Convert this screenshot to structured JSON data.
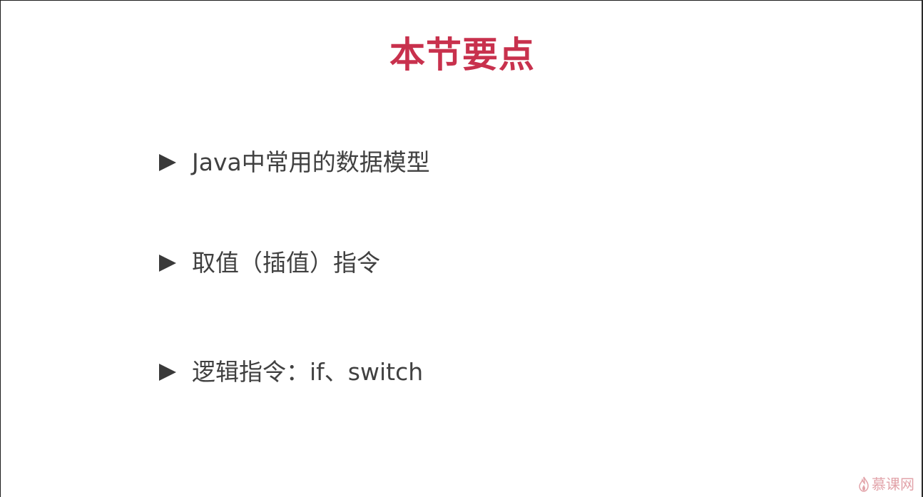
{
  "slide": {
    "title": "本节要点",
    "bullets": [
      {
        "text": "Java中常用的数据模型"
      },
      {
        "text": "取值（插值）指令"
      },
      {
        "text": "逻辑指令：if、switch"
      }
    ]
  },
  "watermark": {
    "text": "慕课网",
    "icon": "flame-icon"
  },
  "colors": {
    "title": "#c8314d",
    "bullet_text": "#404040",
    "bullet_marker": "#3a3a3a",
    "watermark": "#e2a3a9"
  }
}
